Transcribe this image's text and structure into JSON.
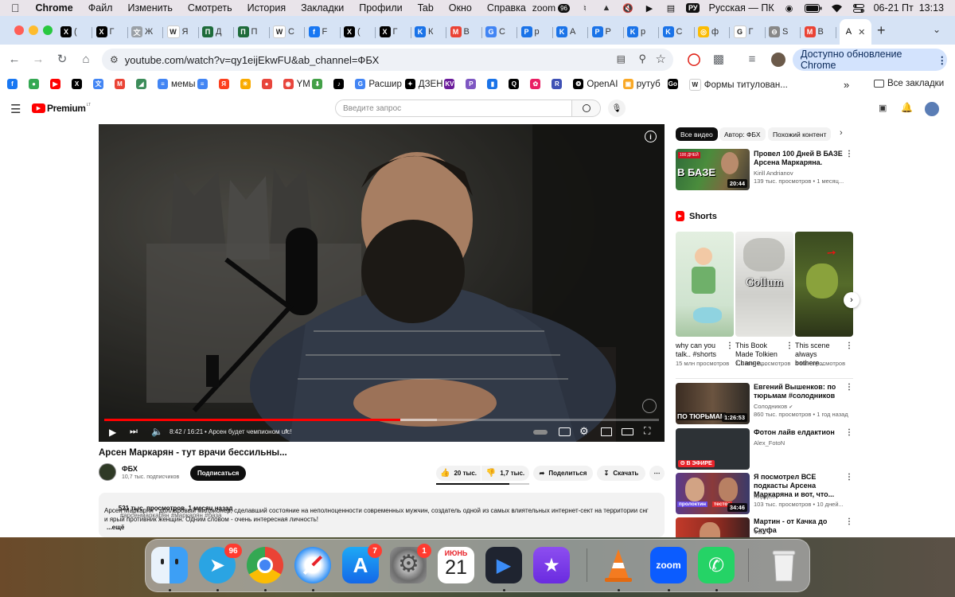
{
  "menubar": {
    "app": "Chrome",
    "items": [
      "Файл",
      "Изменить",
      "Смотреть",
      "История",
      "Закладки",
      "Профили",
      "Tab",
      "Окно",
      "Справка"
    ],
    "zoom_label": "zoom",
    "zoom_badge": "96",
    "input_badge": "РУ",
    "input_language": "Русская — ПК",
    "datetime": "06-21 Пт  13:13"
  },
  "tabs": [
    {
      "icon": "x-icon",
      "label": "(",
      "color": "#000000",
      "glyph": "X"
    },
    {
      "icon": "x-icon",
      "label": "Г",
      "color": "#000000",
      "glyph": "X"
    },
    {
      "icon": "translate-icon",
      "label": "Ж",
      "color": "#9aa0a6",
      "glyph": "文"
    },
    {
      "icon": "wikipedia-icon",
      "label": "Я",
      "color": "#ffffff",
      "glyph": "W"
    },
    {
      "icon": "green-site-icon",
      "label": "Д",
      "color": "#1e6b3b",
      "glyph": "П"
    },
    {
      "icon": "green-site-icon",
      "label": "П",
      "color": "#1e6b3b",
      "glyph": "П"
    },
    {
      "icon": "wikipedia-icon",
      "label": "С",
      "color": "#ffffff",
      "glyph": "W"
    },
    {
      "icon": "facebook-icon",
      "label": "F",
      "color": "#1877f2",
      "glyph": "f"
    },
    {
      "icon": "x-icon",
      "label": "(",
      "color": "#000000",
      "glyph": "X"
    },
    {
      "icon": "x-icon",
      "label": "Г",
      "color": "#000000",
      "glyph": "X"
    },
    {
      "icon": "blue-k-icon",
      "label": "К",
      "color": "#1a73e8",
      "glyph": "K"
    },
    {
      "icon": "gmail-icon",
      "label": "В",
      "color": "#ea4335",
      "glyph": "M"
    },
    {
      "icon": "translate-icon",
      "label": "С",
      "color": "#4285f4",
      "glyph": "G"
    },
    {
      "icon": "blue-p-icon",
      "label": "р",
      "color": "#1a73e8",
      "glyph": "P"
    },
    {
      "icon": "blue-k-icon",
      "label": "А",
      "color": "#1a73e8",
      "glyph": "K"
    },
    {
      "icon": "blue-p-icon",
      "label": "Р",
      "color": "#1a73e8",
      "glyph": "P"
    },
    {
      "icon": "blue-k-icon",
      "label": "р",
      "color": "#1a73e8",
      "glyph": "K"
    },
    {
      "icon": "blue-k-icon",
      "label": "С",
      "color": "#1a73e8",
      "glyph": "K"
    },
    {
      "icon": "chrome-icon",
      "label": "ф",
      "color": "#fbbc04",
      "glyph": "◎"
    },
    {
      "icon": "google-icon",
      "label": "Г",
      "color": "#ffffff",
      "glyph": "G"
    },
    {
      "icon": "site-icon",
      "label": "S",
      "color": "#888888",
      "glyph": "⊖"
    },
    {
      "icon": "gmail-icon",
      "label": "В",
      "color": "#ea4335",
      "glyph": "M"
    }
  ],
  "active_tab_label": "А",
  "omnibox": {
    "url": "youtube.com/watch?v=qy1eijEkwFU&ab_channel=ФБХ"
  },
  "update_button": "Доступно обновление Chrome",
  "bookmarks": [
    {
      "icon": "facebook-icon",
      "label": "",
      "color": "#1877f2",
      "glyph": "f"
    },
    {
      "icon": "maps-icon",
      "label": "",
      "color": "#34a853",
      "glyph": "●"
    },
    {
      "icon": "youtube-icon",
      "label": "",
      "color": "#ff0000",
      "glyph": "▶"
    },
    {
      "icon": "x-icon",
      "label": "",
      "color": "#000000",
      "glyph": "X"
    },
    {
      "icon": "translate-icon",
      "label": "",
      "color": "#4285f4",
      "glyph": "文"
    },
    {
      "icon": "gmail-icon",
      "label": "",
      "color": "#ea4335",
      "glyph": "M"
    },
    {
      "icon": "chart-icon",
      "label": "",
      "color": "#3c8c5a",
      "glyph": "◢"
    },
    {
      "icon": "docs-icon",
      "label": "мемы",
      "color": "#4285f4",
      "glyph": "≡"
    },
    {
      "icon": "docs-icon",
      "label": "",
      "color": "#4285f4",
      "glyph": "≡"
    },
    {
      "icon": "yandex-icon",
      "label": "",
      "color": "#fc3f1d",
      "glyph": "Я"
    },
    {
      "icon": "sun-icon",
      "label": "",
      "color": "#f9ab00",
      "glyph": "☀"
    },
    {
      "icon": "red-circle-icon",
      "label": "",
      "color": "#e8453c",
      "glyph": "●"
    },
    {
      "icon": "ym-icon",
      "label": "YM",
      "color": "#e8453c",
      "glyph": "◉"
    },
    {
      "icon": "download-icon",
      "label": "",
      "color": "#43a047",
      "glyph": "⬇"
    },
    {
      "icon": "tiktok-icon",
      "label": "",
      "color": "#000000",
      "glyph": "♪"
    },
    {
      "icon": "translate-icon",
      "label": "Расшир",
      "color": "#4285f4",
      "glyph": "G"
    },
    {
      "icon": "dzen-icon",
      "label": "ДЗЕН",
      "color": "#000000",
      "glyph": "✦"
    },
    {
      "icon": "kv-icon",
      "label": "",
      "color": "#6a1b9a",
      "glyph": "KV"
    },
    {
      "icon": "p-icon",
      "label": "",
      "color": "#7e57c2",
      "glyph": "P"
    },
    {
      "icon": "chart-icon",
      "label": "",
      "color": "#1a73e8",
      "glyph": "▮"
    },
    {
      "icon": "q-icon",
      "label": "",
      "color": "#000000",
      "glyph": "Q"
    },
    {
      "icon": "flower-icon",
      "label": "",
      "color": "#e91e63",
      "glyph": "✿"
    },
    {
      "icon": "r-icon",
      "label": "",
      "color": "#3f51b5",
      "glyph": "R"
    },
    {
      "icon": "openai-icon",
      "label": "OpenAI",
      "color": "#000000",
      "glyph": "❂"
    },
    {
      "icon": "rutube-icon",
      "label": "рутуб",
      "color": "#f9a825",
      "glyph": "▣"
    },
    {
      "icon": "goal-icon",
      "label": "",
      "color": "#000000",
      "glyph": "Go"
    },
    {
      "icon": "wikipedia-icon",
      "label": "Формы титулован...",
      "color": "#ffffff",
      "glyph": "W"
    }
  ],
  "all_bookmarks": "Все закладки",
  "youtube": {
    "logo_text": "Premium",
    "logo_sup": "LT",
    "search_placeholder": "Введите запрос",
    "player": {
      "time": "8:42 / 16:21",
      "chapter": "• Арсен будет чемпионом ufc!",
      "progress": 0.533,
      "buffered": 0.6
    },
    "video_title": "Арсен Маркарян - тут врачи бессильны...",
    "channel": {
      "name": "ФБХ",
      "subscribers": "10,7 тыс. подписчиков"
    },
    "subscribe": "Подписаться",
    "likes": "20 тыс.",
    "dislikes": "1,7 тыс.",
    "share": "Поделиться",
    "download": "Скачать",
    "description": {
      "meta": "521 тыс. просмотров  1 месяц назад",
      "tags": "#арсенмаркарян #маркарян #база",
      "text": "Арсен Маркарян - долларовый миллионер, сделавший состояние на неполноценности современных мужчин, создатель одной из самых влиятельных интернет-сект на территории снг и ярый противник женщин. Одним словом - очень интересная личность!",
      "more": "...ещё"
    },
    "chips": [
      "Все видео",
      "Автор: ФБХ",
      "Похожий контент"
    ],
    "recommended_top": {
      "title": "Провел 100 Дней В БАЗЕ Арсена Маркаряна. Это...",
      "channel": "Kirill Andrianov",
      "meta": "139 тыс. просмотров • 1 месяц...",
      "duration": "20:44",
      "thumb_text": "В БАЗЕ",
      "thumb_badge": "100 ДНЕЙ"
    },
    "shorts_label": "Shorts",
    "shorts": [
      {
        "title": "why can you talk.. #shorts",
        "views": "15 млн просмотров",
        "thumb_text": ""
      },
      {
        "title": "This Book Made Tolkien Change...",
        "views": "1,1 млн просмотров",
        "thumb_text": "Gollum"
      },
      {
        "title": "This scene always bothere...",
        "views": "4 млн просмотров",
        "thumb_text": ""
      }
    ],
    "recommended": [
      {
        "title": "Евгений Вышенков: по тюрьмам #солодников",
        "channel": "Солодников",
        "verified": true,
        "meta": "860 тыс. просмотров • 1 год назад",
        "duration": "1:26:53",
        "thumb_text": "ПО ТЮРЬМАМ",
        "live": ""
      },
      {
        "title": "Фотон лайв елдактион",
        "channel": "Alex_FotoN",
        "verified": false,
        "meta": "",
        "duration": "",
        "thumb_text": "",
        "live": "В ЭФИРЕ"
      },
      {
        "title": "Я посмотрел ВСЕ подкасты Арсена Маркаряна и вот, что...",
        "channel": "Хидден",
        "verified": false,
        "meta": "103 тыс. просмотров • 10 дней...",
        "duration": "34:46",
        "thumb_text": "пролоктин",
        "thumb_text2": "тестос",
        "live": ""
      },
      {
        "title": "Мартин - от Качка до Скуфа",
        "channel": "ФБХ",
        "verified": false,
        "meta": "",
        "duration": "",
        "thumb_text": "",
        "live": ""
      }
    ]
  },
  "dock": {
    "telegram_badge": "96",
    "appstore_badge": "7",
    "settings_badge": "1",
    "calendar_month": "ИЮНЬ",
    "calendar_day": "21",
    "zoom_label": "zoom"
  }
}
